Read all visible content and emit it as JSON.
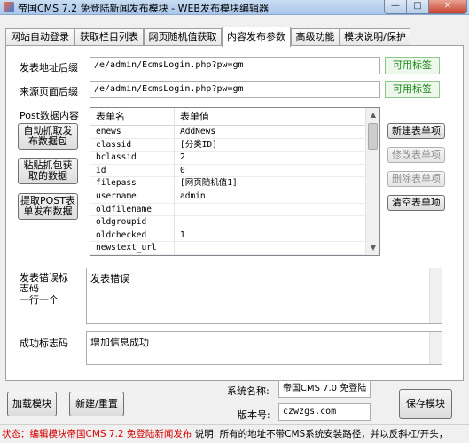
{
  "window": {
    "title": "帝国CMS 7.2 免登陆新闻发布模块 - WEB发布模块编辑器",
    "min_glyph": "—",
    "max_glyph": "□",
    "close_glyph": "✕"
  },
  "tabs": [
    {
      "label": "网站自动登录"
    },
    {
      "label": "获取栏目列表"
    },
    {
      "label": "网页随机值获取"
    },
    {
      "label": "内容发布参数"
    },
    {
      "label": "高级功能"
    },
    {
      "label": "模块说明/保护"
    }
  ],
  "content": {
    "post_url_label": "发表地址后缀",
    "post_url_value": "/e/admin/EcmsLogin.php?pw=gm",
    "source_url_label": "来源页面后缀",
    "source_url_value": "/e/admin/EcmsLogin.php?pw=gm",
    "available_tags_label": "可用标签",
    "post_data_label": "Post数据内容",
    "auto_grab_button": "自动抓取发布数据包",
    "paste_grab_button": "粘贴抓包获取的数据",
    "extract_post_button": "提取POST表单发布数据",
    "grid": {
      "header_name": "表单名",
      "header_value": "表单值",
      "rows": [
        {
          "name": "enews",
          "value": "AddNews"
        },
        {
          "name": "classid",
          "value": "[分类ID]"
        },
        {
          "name": "bclassid",
          "value": "2"
        },
        {
          "name": "id",
          "value": "0"
        },
        {
          "name": "filepass",
          "value": "[网页随机值1]"
        },
        {
          "name": "username",
          "value": "admin"
        },
        {
          "name": "oldfilename",
          "value": ""
        },
        {
          "name": "oldgroupid",
          "value": ""
        },
        {
          "name": "oldchecked",
          "value": "1"
        },
        {
          "name": "newstext_url",
          "value": ""
        }
      ],
      "scroll_up": "▲",
      "scroll_down": "▼"
    },
    "new_item_button": "新建表单项",
    "edit_item_button": "修改表单项",
    "delete_item_button": "删除表单项",
    "clear_items_button": "清空表单项",
    "error_label": "发表错误标志码\n一行一个",
    "error_label_line1": "发表错误标",
    "error_label_line2": "志码",
    "error_label_line3": "一行一个",
    "error_value": "发表错误",
    "success_label": "成功标志码",
    "success_value": "增加信息成功"
  },
  "footer": {
    "load_module_button": "加载模块",
    "new_reset_button": "新建/重置",
    "system_name_label": "系统名称:",
    "system_name_value": "帝国CMS 7.0 免登陆",
    "version_label": "版本号:",
    "version_value": "czwzgs.com",
    "save_module_button": "保存模块"
  },
  "status": {
    "left": "状态：编辑模块帝国CMS 7.2 免登陆新闻发布",
    "right": " 说明: 所有的地址不带CMS系统安装路径，并以反斜杠/开头，"
  }
}
